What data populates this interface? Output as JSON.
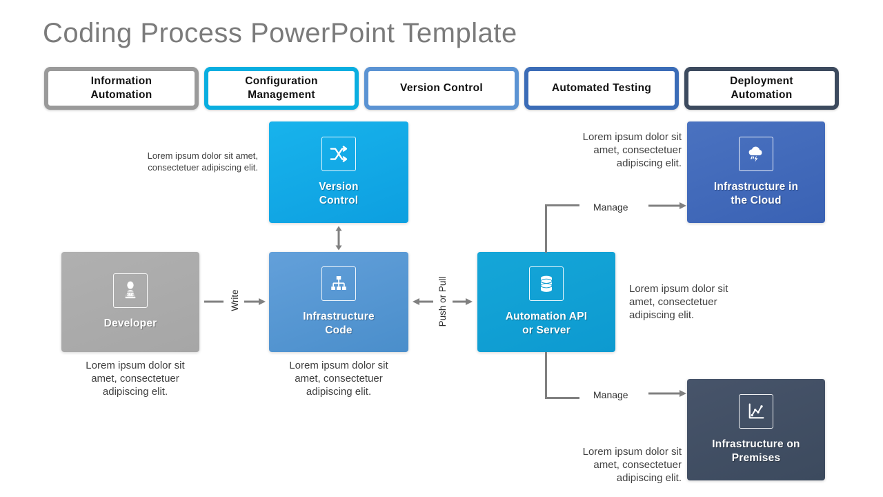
{
  "title": "Coding Process PowerPoint Template",
  "tabs": [
    {
      "label": "Information\nAutomation",
      "color": "#9a9a9a"
    },
    {
      "label": "Configuration\nManagement",
      "color": "#0aaee0"
    },
    {
      "label": "Version  Control",
      "color": "#5b93d3"
    },
    {
      "label": "Automated Testing",
      "color": "#3b6cb7"
    },
    {
      "label": "Deployment\nAutomation",
      "color": "#3c4a5e"
    }
  ],
  "nodes": {
    "version_control": {
      "label": "Version\nControl",
      "icon": "shuffle-icon",
      "color_from": "#18b3ec",
      "color_to": "#0d9fe0"
    },
    "developer": {
      "label": "Developer",
      "icon": "developer-icon",
      "color_from": "#b0b0b0",
      "color_to": "#a6a6a6"
    },
    "infrastructure_code": {
      "label": "Infrastructure\nCode",
      "icon": "hierarchy-icon",
      "color_from": "#63a0da",
      "color_to": "#4a8ecb"
    },
    "automation_api": {
      "label": "Automation  API\nor Server",
      "icon": "database-icon",
      "color_from": "#15a6d8",
      "color_to": "#0d9ad0"
    },
    "infrastructure_cloud": {
      "label": "Infrastructure in\nthe Cloud",
      "icon": "cloud-storm-icon",
      "color_from": "#4a72c0",
      "color_to": "#3a62b4"
    },
    "infrastructure_premises": {
      "label": "Infrastructure  on\nPremises",
      "icon": "line-chart-icon",
      "color_from": "#47546a",
      "color_to": "#3c4a5e"
    }
  },
  "connectors": {
    "write": "Write",
    "push_or_pull": "Push  or  Pull",
    "manage_top": "Manage",
    "manage_bottom": "Manage"
  },
  "paragraphs": {
    "version_control_note": "Lorem  ipsum  dolor  sit amet,\nconsectetuer adipiscing  elit.",
    "cloud_note": "Lorem ipsum dolor sit\namet, consectetuer\nadipiscing elit.",
    "developer_note": "Lorem ipsum dolor sit\namet, consectetuer\nadipiscing elit.",
    "infrastructure_code_note": "Lorem ipsum dolor sit\namet, consectetuer\nadipiscing elit.",
    "automation_api_note": "Lorem ipsum dolor sit\namet, consectetuer\nadipiscing elit.",
    "premises_note": "Lorem ipsum dolor sit\namet, consectetuer\nadipiscing elit."
  },
  "colors": {
    "title": "#7b7b7b",
    "connector": "#808080",
    "body_text": "#404040"
  }
}
